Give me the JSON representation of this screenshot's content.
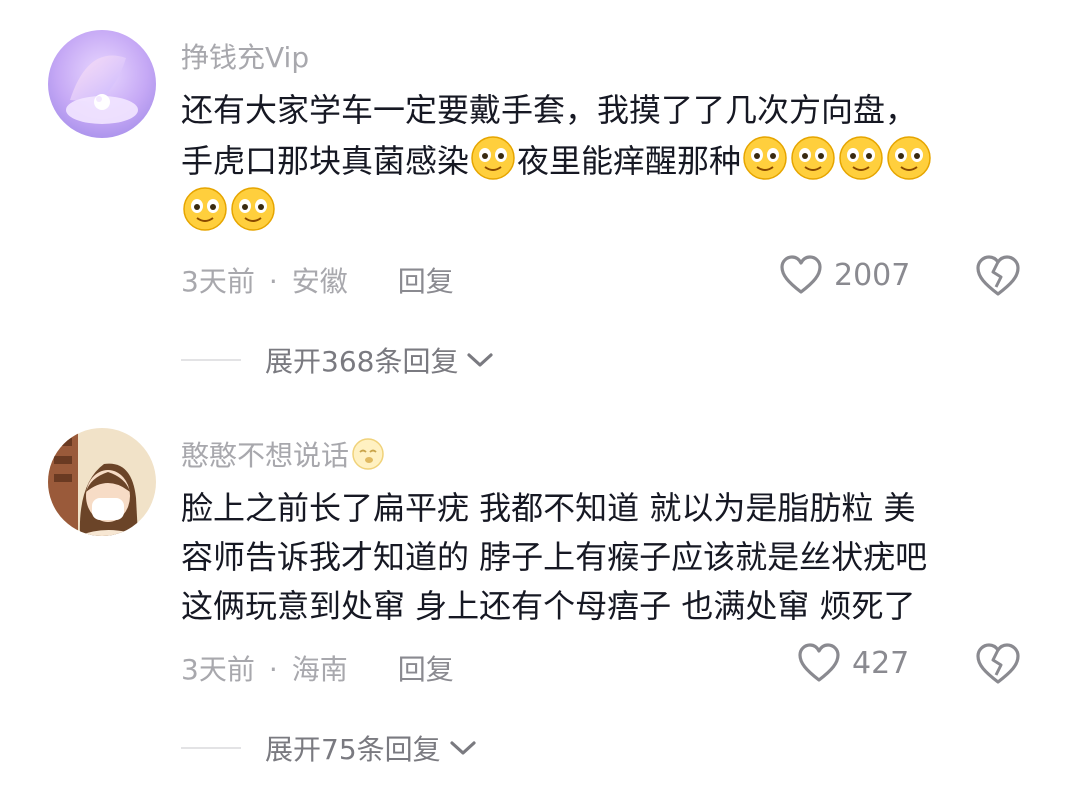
{
  "comments": [
    {
      "username": "挣钱充Vip",
      "text_parts": [
        "还有大家学车一定要戴手套，我摸了了几次方向盘，",
        "手虎口那块真菌感染",
        "夜里能痒醒那种"
      ],
      "time": "3天前",
      "separator": "·",
      "location": "安徽",
      "reply_label": "回复",
      "like_count": "2007",
      "expand_label": "展开368条回复",
      "icons": {
        "avatar": "pearl-shell-avatar",
        "emoji": "smile-emoji",
        "like": "heart-outline-icon",
        "dislike": "broken-heart-icon",
        "expand": "chevron-down-icon"
      }
    },
    {
      "username": "憨憨不想说话",
      "lines": [
        "脸上之前长了扁平疣 我都不知道 就以为是脂肪粒 美",
        "容师告诉我才知道的 脖子上有瘊子应该就是丝状疣吧",
        "这俩玩意到处窜 身上还有个母痦子 也满处窜 烦死了"
      ],
      "time": "3天前",
      "separator": "·",
      "location": "海南",
      "reply_label": "回复",
      "like_count": "427",
      "expand_label": "展开75条回复",
      "icons": {
        "avatar": "girl-mask-avatar",
        "badge": "sleepy-emoji",
        "like": "heart-outline-icon",
        "dislike": "broken-heart-icon",
        "expand": "chevron-down-icon"
      }
    }
  ]
}
